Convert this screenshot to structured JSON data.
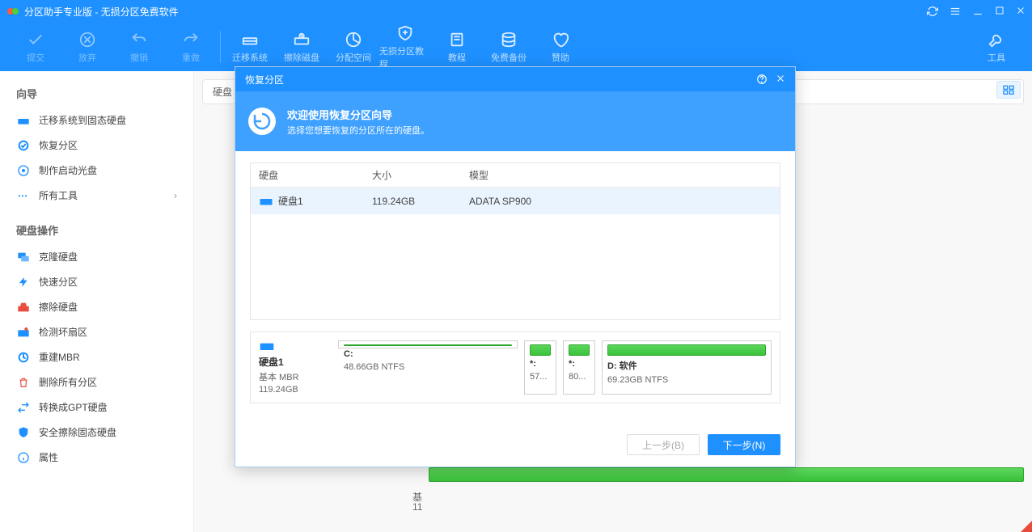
{
  "titlebar": {
    "title": "分区助手专业版 - 无损分区免费软件"
  },
  "toolbar": {
    "commit": "提交",
    "discard": "放弃",
    "undo": "撤销",
    "redo": "重做",
    "migrate": "迁移系统",
    "wipe_disk": "擦除磁盘",
    "allocate": "分配空间",
    "lossless": "无损分区教程",
    "tutorial": "教程",
    "backup": "免费备份",
    "donate": "赞助",
    "tools": "工具"
  },
  "sidebar": {
    "wizard_header": "向导",
    "wizard_items": [
      {
        "label": "迁移系统到固态硬盘"
      },
      {
        "label": "恢复分区"
      },
      {
        "label": "制作启动光盘"
      },
      {
        "label": "所有工具"
      }
    ],
    "ops_header": "硬盘操作",
    "ops_items": [
      {
        "label": "克隆硬盘"
      },
      {
        "label": "快速分区"
      },
      {
        "label": "擦除硬盘"
      },
      {
        "label": "检测坏扇区"
      },
      {
        "label": "重建MBR"
      },
      {
        "label": "删除所有分区"
      },
      {
        "label": "转换成GPT硬盘"
      },
      {
        "label": "安全擦除固态硬盘"
      },
      {
        "label": "属性"
      }
    ]
  },
  "content": {
    "disk_header": "硬盘",
    "bg_l1": "基",
    "bg_l2": "11"
  },
  "modal": {
    "title": "恢复分区",
    "banner_title": "欢迎使用恢复分区向导",
    "banner_sub": "选择您想要恢复的分区所在的硬盘。",
    "table": {
      "h_disk": "硬盘",
      "h_size": "大小",
      "h_model": "模型",
      "row": {
        "name": "硬盘1",
        "size": "119.24GB",
        "model": "ADATA SP900"
      }
    },
    "diskrow": {
      "name": "硬盘1",
      "type": "基本 MBR",
      "total": "119.24GB",
      "p1_label": "C:",
      "p1_size": "48.66GB NTFS",
      "p2_label": "*:",
      "p2_size": "57...",
      "p3_label": "*:",
      "p3_size": "80...",
      "p4_label": "D: 软件",
      "p4_size": "69.23GB NTFS"
    },
    "btn_prev": "上一步(B)",
    "btn_next": "下一步(N)"
  }
}
